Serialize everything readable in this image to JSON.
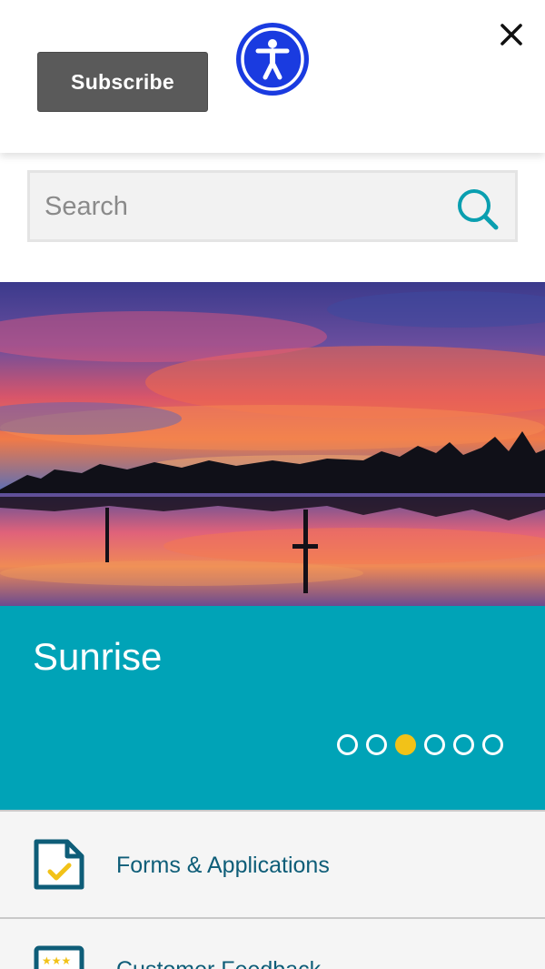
{
  "header": {
    "subscribe_label": "Subscribe",
    "accessibility_icon": "accessibility-icon",
    "close_icon": "close-icon"
  },
  "search": {
    "placeholder": "Search",
    "icon": "search-icon"
  },
  "slideshow": {
    "slide_title": "Sunrise",
    "total_slides": 6,
    "active_index": 2,
    "panel_color": "#00a3b7",
    "active_dot_color": "#f2c218"
  },
  "quick_links": [
    {
      "label": "Forms & Applications",
      "icon": "form-document-icon"
    },
    {
      "label": "Customer Feedback",
      "icon": "feedback-rating-icon"
    }
  ],
  "colors": {
    "accent_teal": "#00a3b7",
    "link_text": "#0e5d78",
    "accessibility_blue": "#1a3be0",
    "subscribe_bg": "#5a5a5a"
  }
}
